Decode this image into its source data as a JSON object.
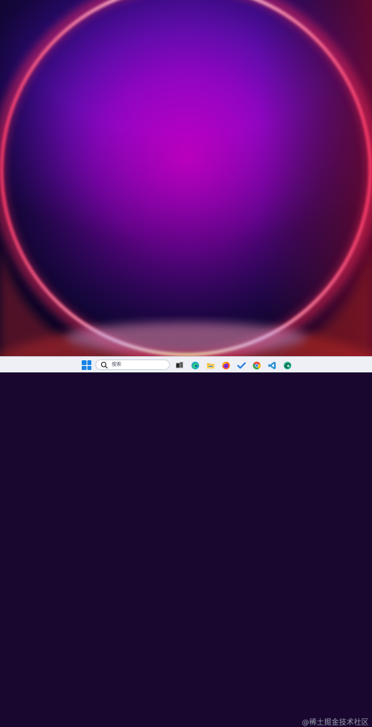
{
  "desktop": {
    "wallpaper": "windows-11-bloom-purple",
    "colors": {
      "center": "#b200c8",
      "edge": "#0b0520",
      "ring_inner": "#ffd36a",
      "ring_mid": "#ff4a7a",
      "ring_outer": "#c81e5a"
    }
  },
  "taskbar": {
    "start_icon": "windows-logo-icon",
    "search": {
      "placeholder": "搜索",
      "icon": "search-icon"
    },
    "pinned_apps": [
      {
        "name": "task-view-icon",
        "color": "#2b2b2b"
      },
      {
        "name": "edge-icon",
        "color": "#1aa0c8"
      },
      {
        "name": "file-explorer-icon",
        "color": "#f3b825"
      },
      {
        "name": "firefox-icon",
        "color": "#ff6a1a"
      },
      {
        "name": "todo-check-icon",
        "color": "#2a7fe0"
      },
      {
        "name": "chrome-icon",
        "color": "#34a853"
      },
      {
        "name": "vscode-icon",
        "color": "#1f8ad6"
      },
      {
        "name": "edge-dev-icon",
        "color": "#2fb58f"
      }
    ]
  },
  "watermark": {
    "text": "@稀土掘金技术社区"
  }
}
